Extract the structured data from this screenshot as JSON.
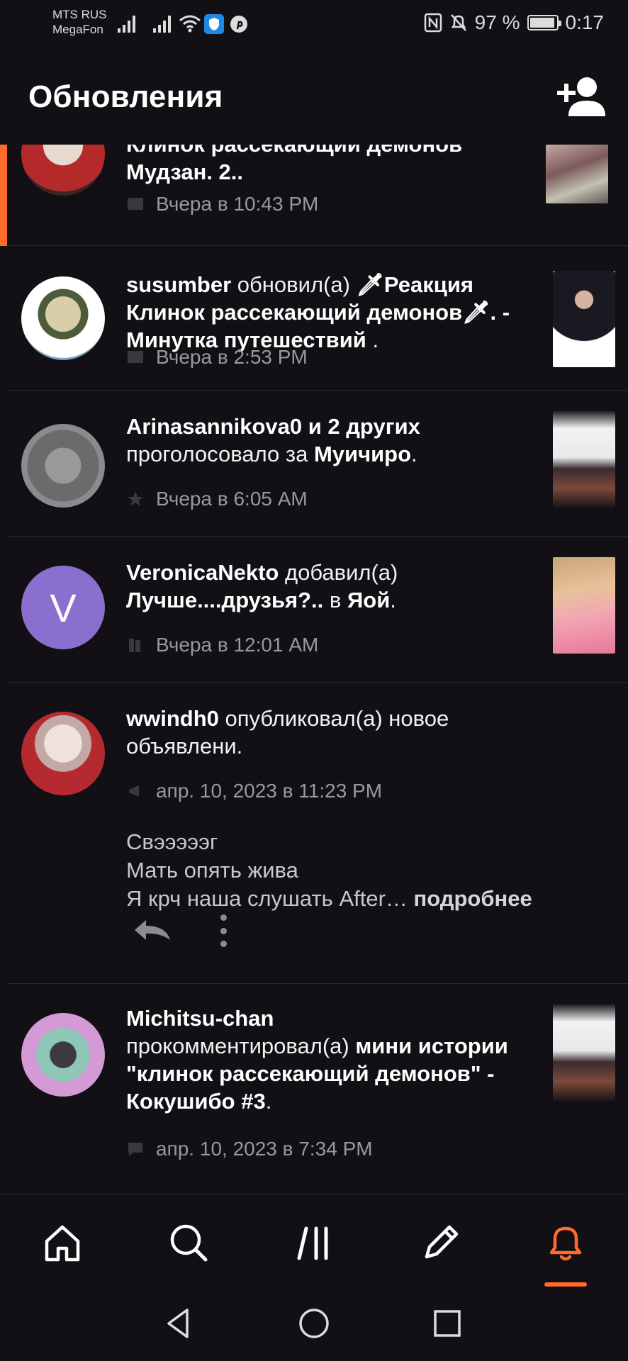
{
  "status_bar": {
    "carrier_line1": "MTS RUS",
    "carrier_line2": "MegaFon",
    "battery": "97 %",
    "time": "0:17",
    "icons": [
      "signal-icon",
      "signal-icon",
      "wifi-icon",
      "shield-icon",
      "pinterest-icon",
      "nfc-icon",
      "mute-icon",
      "battery-icon"
    ]
  },
  "header": {
    "title": "Обновления",
    "add_user_icon": "add-user-icon"
  },
  "accent_color": "#ff6b2c",
  "feed": [
    {
      "text_line1": "Клинок рассекающий демонов",
      "story_title": "Мудзан. 2..",
      "time": "Вчера в 10:43 PM",
      "meta_icon": "book-icon",
      "unread": true
    },
    {
      "user": "susumber",
      "action": "обновил(а)",
      "story_title": "🗡Реакция Клинок рассекающий демонов🗡. - Минутка путешествий",
      "trailing": ".",
      "time": "Вчера в 2:53 PM",
      "meta_icon": "book-icon"
    },
    {
      "user": "Arinasannikova0 и 2 других",
      "action": "проголосовало за",
      "story_title": "Муичиро",
      "trailing": ".",
      "time": "Вчера в 6:05 AM",
      "meta_icon": "star-icon"
    },
    {
      "user": "VeronicaNekto",
      "action": "добавил(а)",
      "story_title": "Лучше....друзья?..",
      "middle": "в",
      "list_name": "Яой",
      "trailing": ".",
      "avatar_letter": "V",
      "avatar_color": "#8a6fcf",
      "time": "Вчера в 12:01 AM",
      "meta_icon": "books-icon"
    },
    {
      "user": "wwindh0",
      "action": "опубликовал(а) новое объявлени.",
      "time": "апр. 10, 2023 в 11:23 PM",
      "meta_icon": "megaphone-icon",
      "post_line1": "Свэээээг",
      "post_line2": "Мать опять жива",
      "post_line3": "Я крч наша слушать After…",
      "more": "подробнее"
    },
    {
      "user": "Michitsu-chan",
      "action": "прокомментировал(а)",
      "story_title": "мини истории \"клинок рассекающий демонов\" - Кокушибо #3",
      "trailing": ".",
      "time": "апр. 10, 2023 в 7:34 PM",
      "meta_icon": "comment-icon"
    }
  ],
  "bottom_nav": [
    {
      "icon": "home-icon",
      "active": false
    },
    {
      "icon": "search-icon",
      "active": false
    },
    {
      "icon": "library-icon",
      "active": false
    },
    {
      "icon": "pencil-icon",
      "active": false
    },
    {
      "icon": "bell-icon",
      "active": true
    }
  ],
  "system_nav": [
    "back-icon",
    "home-circle-icon",
    "recents-icon"
  ]
}
